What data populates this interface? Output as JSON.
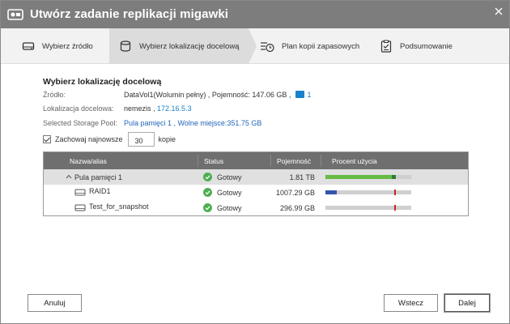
{
  "window": {
    "title": "Utwórz zadanie replikacji migawki"
  },
  "steps": [
    {
      "label": "Wybierz źródło",
      "icon": "drive-icon"
    },
    {
      "label": "Wybierz lokalizację docelową",
      "icon": "database-icon"
    },
    {
      "label": "Plan kopii zapasowych",
      "icon": "schedule-icon"
    },
    {
      "label": "Podsumowanie",
      "icon": "clipboard-icon"
    }
  ],
  "active_step": 1,
  "form": {
    "section_title": "Wybierz lokalizację docelową",
    "source_label": "Źródło:",
    "source_value": "DataVol1(Wolumin pełny) , Pojemność: 147.06 GB ,",
    "source_badge": "1",
    "target_label": "Lokalizacja docelowa:",
    "target_host": "nemezis ,",
    "target_ip": "172.16.5.3",
    "pool_label": "Selected Storage Pool:",
    "pool_value": "Pula pamięci 1 , Wolne miejsce:351.75 GB",
    "keep_label": "Zachowaj najnowsze",
    "keep_value": "30",
    "keep_suffix": "kopie"
  },
  "table": {
    "columns": [
      "Nazwa/alias",
      "Status",
      "Pojemność",
      "Procent użycia"
    ],
    "rows": [
      {
        "name": "Pula pamięci 1",
        "status": "Gotowy",
        "capacity": "1.81 TB",
        "usage_fraction": 0.82,
        "bar_color": "#66bb44",
        "mark_color": "#2e7d32",
        "type": "pool"
      },
      {
        "name": "RAID1",
        "status": "Gotowy",
        "capacity": "1007.29 GB",
        "usage_fraction": 0.13,
        "bar_color": "#3355aa",
        "mark_color": "#cc2222",
        "type": "volume"
      },
      {
        "name": "Test_for_snapshot",
        "status": "Gotowy",
        "capacity": "296.99 GB",
        "usage_fraction": 0.0,
        "bar_color": "#3355aa",
        "mark_color": "#cc2222",
        "type": "volume"
      }
    ]
  },
  "buttons": {
    "cancel": "Anuluj",
    "back": "Wstecz",
    "next": "Dalej"
  },
  "colors": {
    "titlebar": "#7d7d7d",
    "accent": "#1a82c9",
    "ok_green": "#4caf50"
  }
}
